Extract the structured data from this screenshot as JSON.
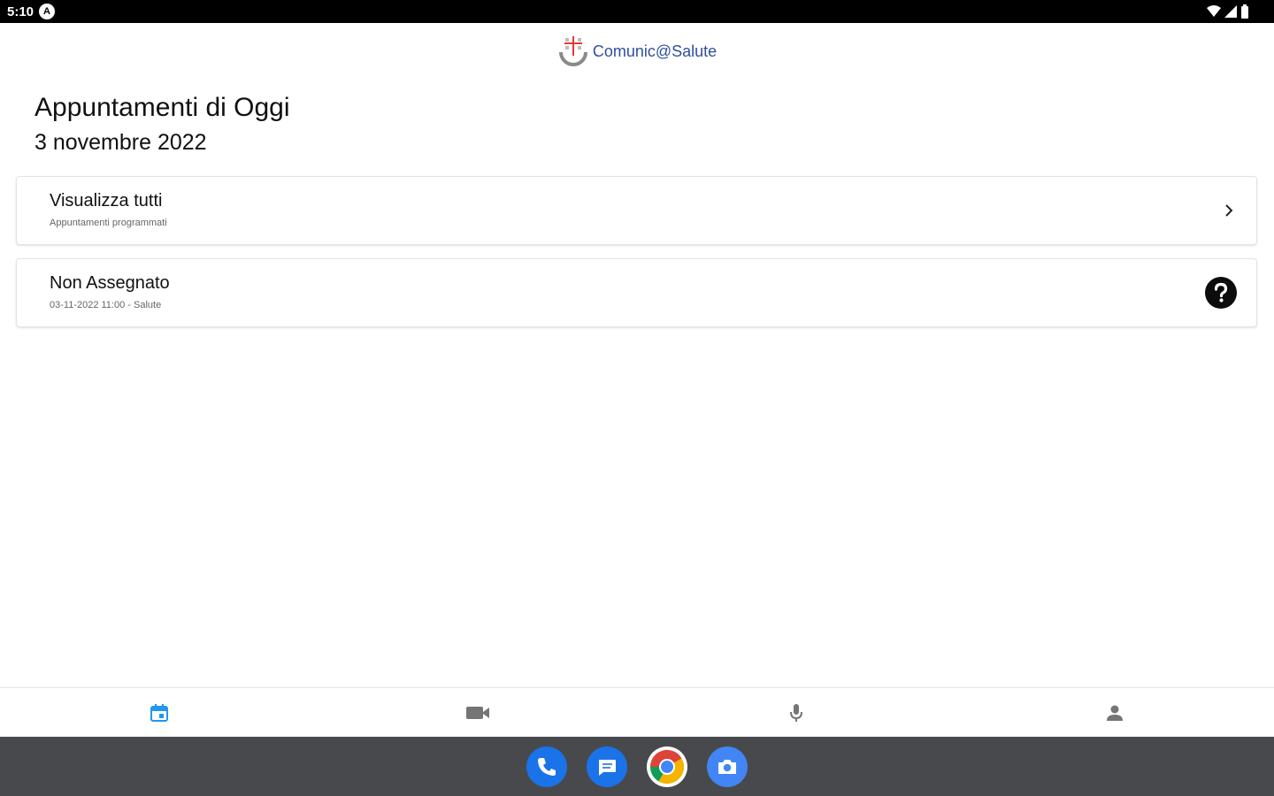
{
  "status_bar": {
    "time": "5:10",
    "notification_letter": "A"
  },
  "app": {
    "logo_text": "Comunic@Salute"
  },
  "page": {
    "title": "Appuntamenti di Oggi",
    "date": "3 novembre 2022"
  },
  "cards": [
    {
      "title": "Visualizza tutti",
      "subtitle": "Appuntamenti programmati",
      "icon": "chevron-right-icon"
    },
    {
      "title": "Non Assegnato",
      "subtitle": "03-11-2022 11:00 - Salute",
      "icon": "help-circle-icon"
    }
  ],
  "bottom_nav": [
    {
      "icon": "calendar-icon",
      "active": true
    },
    {
      "icon": "video-camera-icon",
      "active": false
    },
    {
      "icon": "microphone-icon",
      "active": false
    },
    {
      "icon": "person-icon",
      "active": false
    }
  ],
  "dock": [
    "phone-icon",
    "messages-icon",
    "chrome-icon",
    "camera-icon"
  ],
  "colors": {
    "accent": "#2196f3",
    "logo_text": "#2f4f9e",
    "nav_inactive": "#757575",
    "system_bar": "#48494c"
  }
}
